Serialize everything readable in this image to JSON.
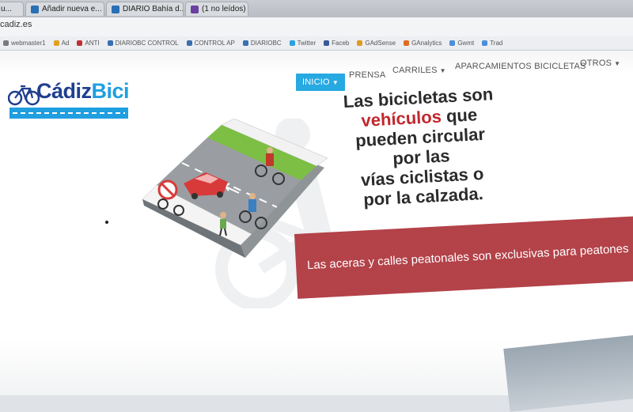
{
  "browser": {
    "tabs": [
      {
        "label": "u...",
        "favicon_color": "#6b7b8c"
      },
      {
        "label": "Añadir nueva e...",
        "favicon_color": "#2a6fb5"
      },
      {
        "label": "DIARIO Bahía d...",
        "favicon_color": "#2a6fb5"
      },
      {
        "label": "(1 no leídos)",
        "favicon_color": "#6b3fa0"
      }
    ],
    "url": "cadiz.es",
    "bookmarks": [
      {
        "label": "webmaster1",
        "color": "#7a7a7a"
      },
      {
        "label": "Ad",
        "color": "#e0a020"
      },
      {
        "label": "ANTI",
        "color": "#c03030"
      },
      {
        "label": "DIARIOBC CONTROL",
        "color": "#3a6fb0"
      },
      {
        "label": "CONTROL AP",
        "color": "#3a6fb0"
      },
      {
        "label": "DIARIOBC",
        "color": "#3a6fb0"
      },
      {
        "label": "Twitter",
        "color": "#29a3e0"
      },
      {
        "label": "Faceb",
        "color": "#3b5998"
      },
      {
        "label": "GAdSense",
        "color": "#e09a20"
      },
      {
        "label": "GAnalytics",
        "color": "#e06a20"
      },
      {
        "label": "Gwmt",
        "color": "#4a90d9"
      },
      {
        "label": "Trad",
        "color": "#4a90d9"
      }
    ]
  },
  "logo": {
    "part1": "Cádiz",
    "part2": "Bici"
  },
  "nav": {
    "inicio": "INICIO",
    "prensa": "PRENSA",
    "carriles": "CARRILES",
    "aparcamientos": "APARCAMIENTOS BICICLETAS",
    "otros": "OTROS"
  },
  "hero": {
    "line1": "Las bicicletas son",
    "line2_red": "vehículos",
    "line2_rest": " que",
    "line3": "pueden circular",
    "line4": "por las",
    "line5": "vías ciclistas o",
    "line6": "por la calzada."
  },
  "banner": {
    "text": "Las aceras y calles peatonales son exclusivas para peatones"
  },
  "colors": {
    "accent": "#27a9e1",
    "banner": "#b34249",
    "red_text": "#c2272d",
    "logo_dark": "#1f3f8f"
  }
}
